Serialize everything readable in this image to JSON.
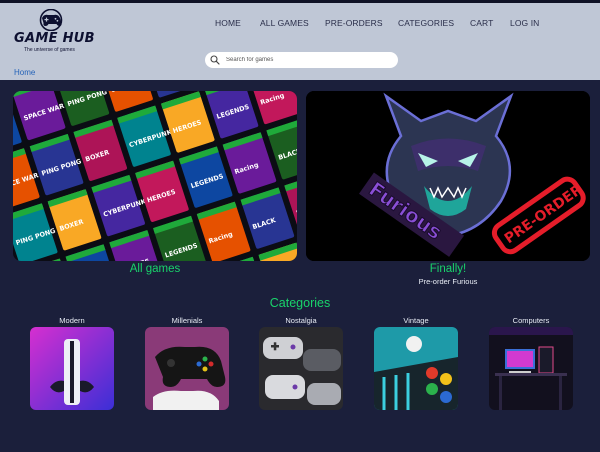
{
  "logo": {
    "title": "GAME HUB",
    "tagline": "The universe of games"
  },
  "nav": [
    {
      "label": "HOME"
    },
    {
      "label": "ALL GAMES"
    },
    {
      "label": "PRE-ORDERS"
    },
    {
      "label": "CATEGORIES"
    },
    {
      "label": "CART"
    },
    {
      "label": "LOG IN"
    }
  ],
  "search": {
    "placeholder": "Search for games",
    "value": ""
  },
  "breadcrumb": "Home",
  "featured": [
    {
      "caption": "All games",
      "subcaption": ""
    },
    {
      "caption": "Finally!",
      "subcaption": "Pre-order Furious",
      "art_word": "Furious",
      "art_stamp": "PRE-ORDER"
    }
  ],
  "covers": [
    "Racing",
    "BLACK",
    "SPACE WAR",
    "PING PONG",
    "BOXER",
    "CYBERPUNK",
    "HEROES",
    "LEGENDS"
  ],
  "categories_heading": "Categories",
  "categories": [
    {
      "label": "Modern",
      "icon": "console-icon"
    },
    {
      "label": "Millenials",
      "icon": "gamepad-icon"
    },
    {
      "label": "Nostalgia",
      "icon": "retro-controllers-icon"
    },
    {
      "label": "Vintage",
      "icon": "arcade-buttons-icon"
    },
    {
      "label": "Computers",
      "icon": "pc-setup-icon"
    }
  ],
  "colors": {
    "background": "#1b1f3b",
    "header": "#bfc7d6",
    "accent": "#19d36b",
    "link": "#2563b8"
  }
}
